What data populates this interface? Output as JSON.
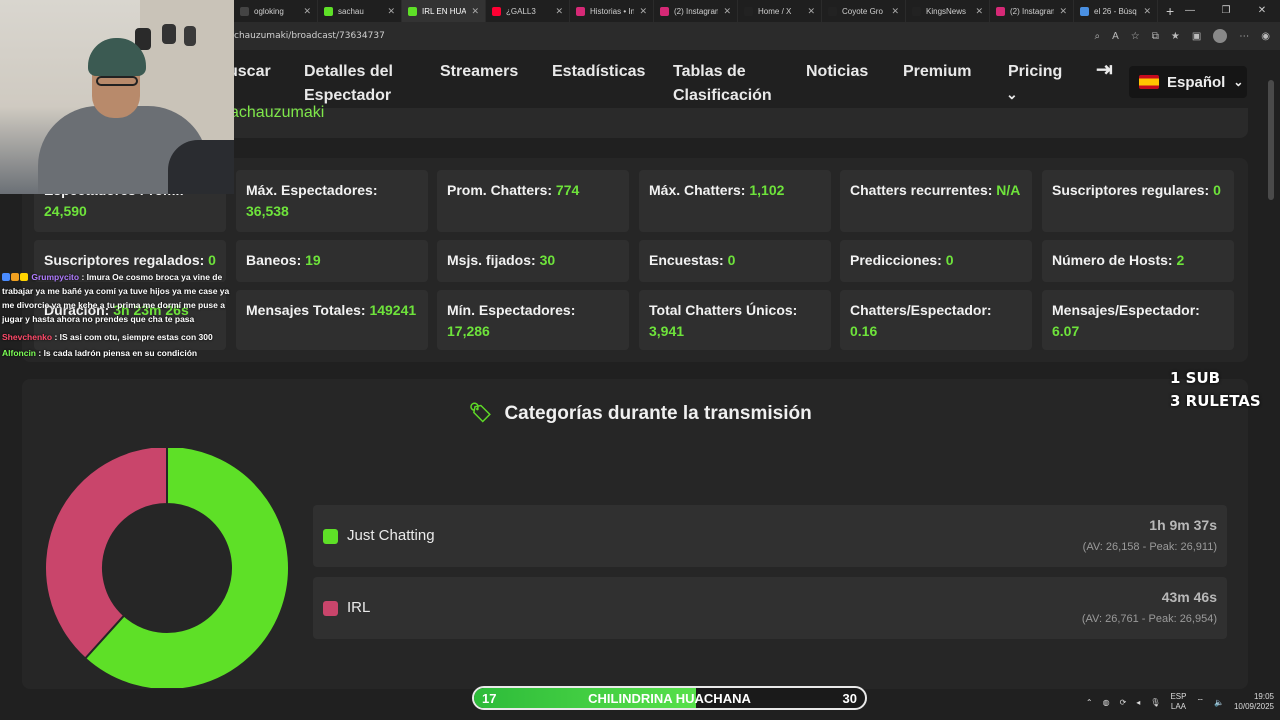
{
  "browser": {
    "tabs": [
      {
        "label": "ogloking",
        "fav": "#444"
      },
      {
        "label": "sachau",
        "fav": "#5ee027"
      },
      {
        "label": "IRL EN HUA",
        "fav": "#5ee027"
      },
      {
        "label": "¿GALL3",
        "fav": "#ff0033"
      },
      {
        "label": "Historias • In",
        "fav": "#d62976"
      },
      {
        "label": "(2) Instagram",
        "fav": "#d62976"
      },
      {
        "label": "Home / X",
        "fav": "#222"
      },
      {
        "label": "Coyote Gro",
        "fav": "#222"
      },
      {
        "label": "KingsNews",
        "fav": "#222"
      },
      {
        "label": "(2) Instagram",
        "fav": "#d62976"
      },
      {
        "label": "el 26 - Búsq",
        "fav": "#4a90e2"
      }
    ],
    "url": "chauzumaki/broadcast/73634737"
  },
  "nav": {
    "items": [
      "uscar",
      "Detalles del Espectador",
      "Streamers",
      "Estadísticas",
      "Tablas de Clasificación",
      "Noticias",
      "Premium",
      "Pricing"
    ],
    "language": "Español"
  },
  "streamer_name": "achauzumaki",
  "stats": [
    {
      "label": "Espectadores Prom.:",
      "value": "24,590"
    },
    {
      "label": "Máx. Espectadores:",
      "value": "36,538"
    },
    {
      "label": "Prom. Chatters:",
      "value": "774"
    },
    {
      "label": "Máx. Chatters:",
      "value": "1,102"
    },
    {
      "label": "Chatters recurrentes:",
      "value": "N/A"
    },
    {
      "label": "Suscriptores regulares:",
      "value": "0"
    },
    {
      "label": "Suscriptores regalados:",
      "value": "0"
    },
    {
      "label": "Baneos:",
      "value": "19"
    },
    {
      "label": "Msjs. fijados:",
      "value": "30"
    },
    {
      "label": "Encuestas:",
      "value": "0"
    },
    {
      "label": "Predicciones:",
      "value": "0"
    },
    {
      "label": "Número de Hosts:",
      "value": "2"
    },
    {
      "label": "Duración:",
      "value": "3h 23m 26s"
    },
    {
      "label": "Mensajes Totales:",
      "value": "149241"
    },
    {
      "label": "Mín. Espectadores:",
      "value": "17,286"
    },
    {
      "label": "Total Chatters Únicos:",
      "value": "3,941"
    },
    {
      "label": "Chatters/Espectador:",
      "value": "0.16"
    },
    {
      "label": "Mensajes/Espectador:",
      "value": "6.07"
    }
  ],
  "categories_title": "Categorías durante la transmisión",
  "categories": [
    {
      "name": "Just Chatting",
      "time": "1h 9m 37s",
      "av": "(AV: 26,158 - Peak: 26,911)",
      "color": "#5ee027",
      "share": 0.617
    },
    {
      "name": "IRL",
      "time": "43m 46s",
      "av": "(AV: 26,761 - Peak: 26,954)",
      "color": "#c9456b",
      "share": 0.383
    }
  ],
  "chat": [
    {
      "user": "Grumpycito",
      "msg": ": Imura Oe cosmo broca ya vine de trabajar ya me bañé ya comí ya tuve hijos ya me case ya me divorcie ya me kche a tu prima me dormí me puse a jugar y hasta ahora no prendes que cha te pasa"
    },
    {
      "user": "Shevchenko",
      "msg": ": IS asi com otu, siempre estas con 300"
    },
    {
      "user": "Alfoncin",
      "msg": ": ls cada ladrón piensa en su condición"
    }
  ],
  "sub_note": [
    "1 SUB",
    "3 RULETAS"
  ],
  "goal": {
    "current": "17",
    "label": "CHILINDRINA HUACHANA",
    "target": "30",
    "progress": 0.567
  },
  "tray": {
    "lang_top": "ESP",
    "lang_bottom": "LAA",
    "time": "19:05",
    "date": "10/09/2025"
  }
}
